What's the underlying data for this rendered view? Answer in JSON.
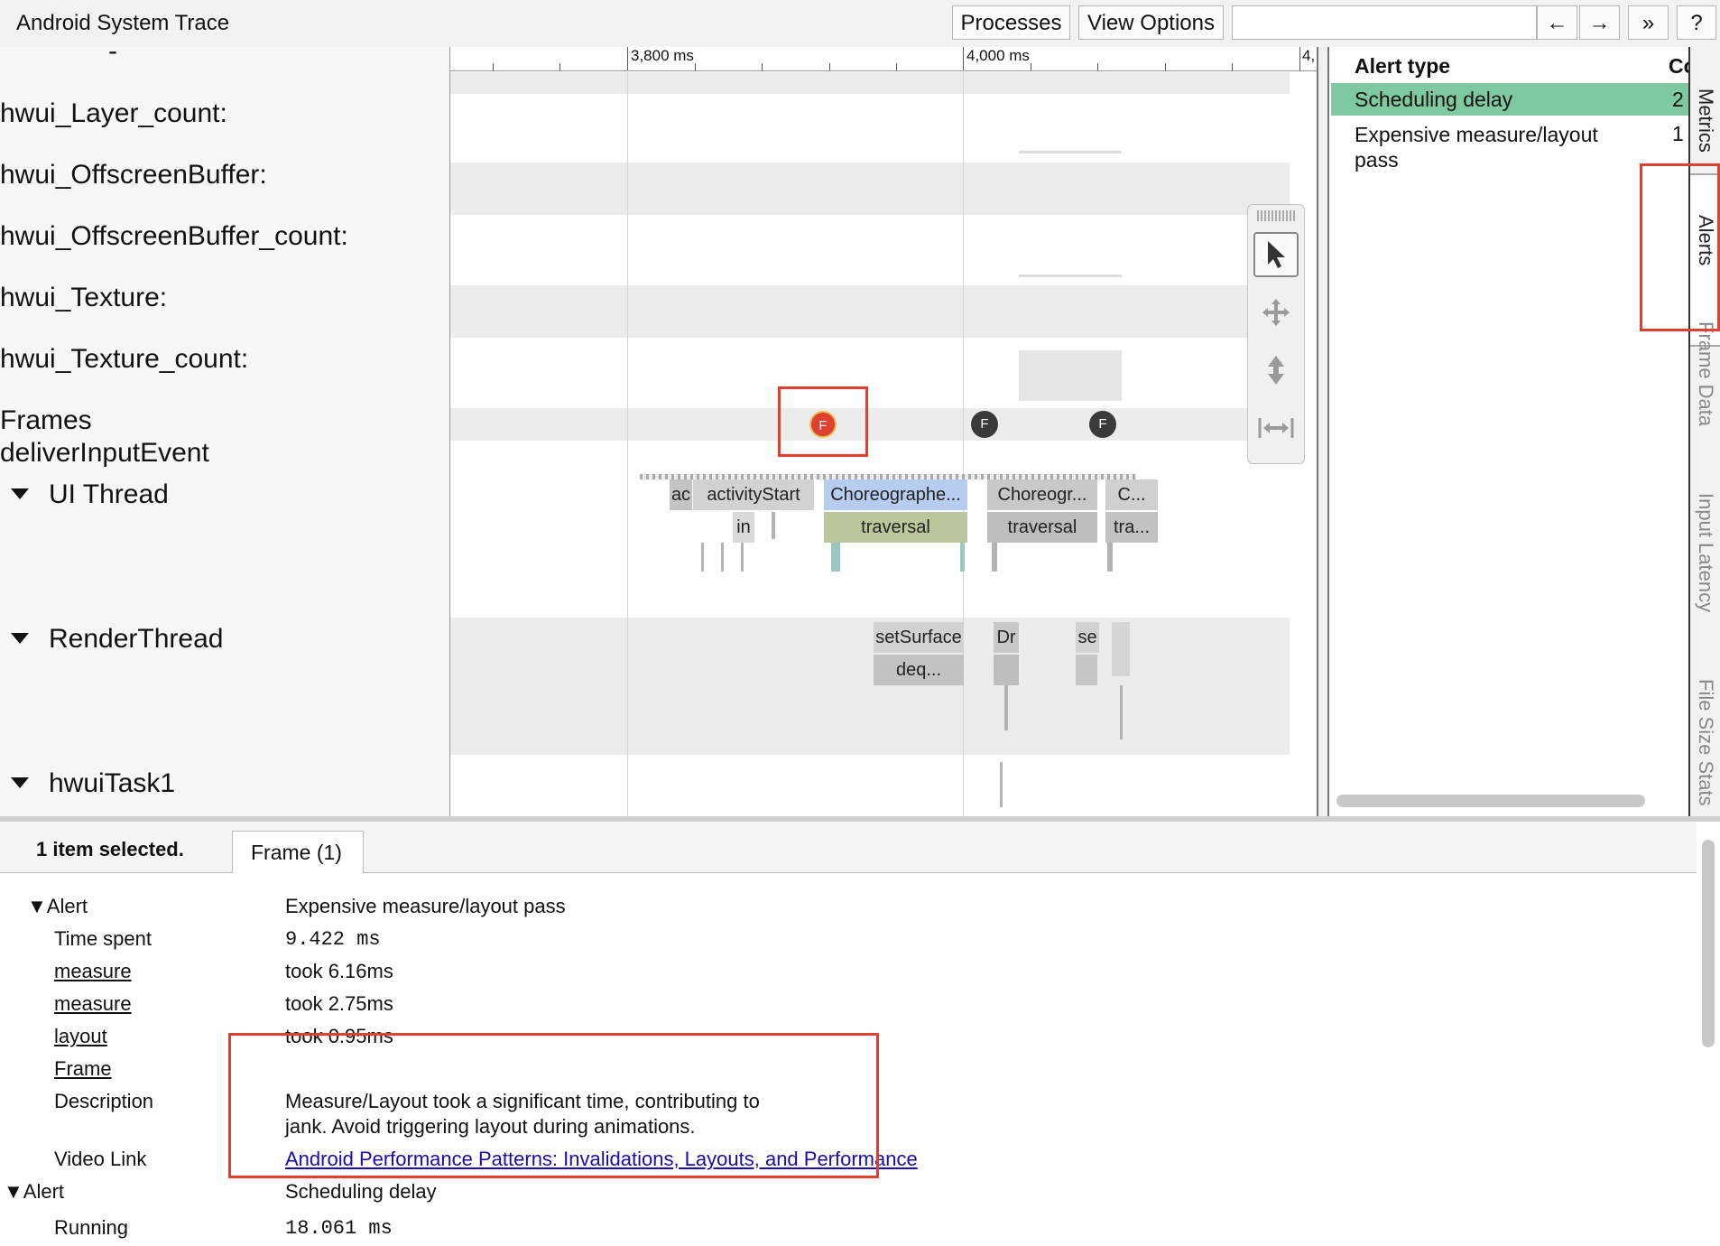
{
  "app": {
    "title": "Android System Trace"
  },
  "toolbar": {
    "processes": "Processes",
    "view_options": "View Options",
    "search_placeholder": "",
    "prev": "←",
    "next": "→",
    "more": "»",
    "help": "?"
  },
  "tracks": {
    "top_partial": "-",
    "hwui_layer_count": "hwui_Layer_count:",
    "hwui_offscreenbuffer": "hwui_OffscreenBuffer:",
    "hwui_offscreenbuffer_count": "hwui_OffscreenBuffer_count:",
    "hwui_texture": "hwui_Texture:",
    "hwui_texture_count": "hwui_Texture_count:",
    "frames": "Frames",
    "deliver_input_event": "deliverInputEvent",
    "ui_thread": "UI Thread",
    "render_thread": "RenderThread",
    "hwui_task1": "hwuiTask1"
  },
  "ruler": {
    "t1": "3,800 ms",
    "t2": "4,000 ms",
    "t3": "4,"
  },
  "frames": {
    "marker": "F"
  },
  "slices": {
    "ac": "ac",
    "activity_start": "activityStart",
    "in": "in",
    "choreographer1": "Choreographe...",
    "traversal1": "traversal",
    "choreographer2": "Choreogr...",
    "traversal2": "traversal",
    "c3": "C...",
    "tra3": "tra...",
    "set_surface": "setSurface",
    "deq": "deq...",
    "dr": "Dr",
    "se": "se"
  },
  "alerts_panel": {
    "col_type": "Alert type",
    "col_count": "Co",
    "rows": [
      {
        "type": "Scheduling delay",
        "count": "2"
      },
      {
        "type": "Expensive measure/layout pass",
        "count": "1"
      }
    ]
  },
  "side_tabs": [
    "Metrics",
    "Alerts",
    "Frame Data",
    "Input Latency",
    "File Size Stats"
  ],
  "details": {
    "selection": "1 item selected.",
    "tab": "Frame (1)",
    "alert1": {
      "label": "▼Alert",
      "value": "Expensive measure/layout pass",
      "time_spent_label": "Time spent",
      "time_spent": "9.422 ms",
      "measure1_label": "measure",
      "measure1": "took 6.16ms",
      "measure2_label": "measure",
      "measure2": "took 2.75ms",
      "layout_label": "layout",
      "layout": "took 0.95ms",
      "frame_label": "Frame",
      "description_label": "Description",
      "description_line1": "Measure/Layout took a significant time, contributing to",
      "description_line2": "jank. Avoid triggering layout during animations.",
      "video_label": "Video Link",
      "video_link": "Android Performance Patterns: Invalidations, Layouts, and Performance"
    },
    "alert2": {
      "label": "▼Alert",
      "value": "Scheduling delay",
      "running_label": "Running",
      "running": "18.061 ms"
    }
  },
  "colors": {
    "selected_row": "#7fc9a1",
    "annotation": "#e0402f",
    "link": "#1a0dab"
  }
}
